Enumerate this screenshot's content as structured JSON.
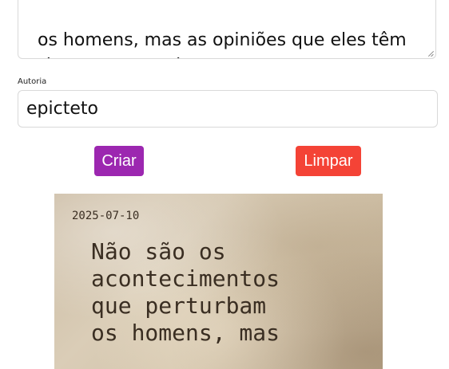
{
  "form": {
    "quote_text": "os homens, mas as opiniões que eles têm\nsobre os acontecimentos.",
    "author_label": "Autoria",
    "author_value": "epicteto",
    "create_label": "Criar",
    "clear_label": "Limpar"
  },
  "card": {
    "date": "2025-07-10",
    "quote_lines": "Não são os\nacontecimentos\nque perturbam\nos homens, mas"
  },
  "colors": {
    "create_button": "#9c27b0",
    "clear_button": "#f44336",
    "card_text": "#3a2e22"
  }
}
